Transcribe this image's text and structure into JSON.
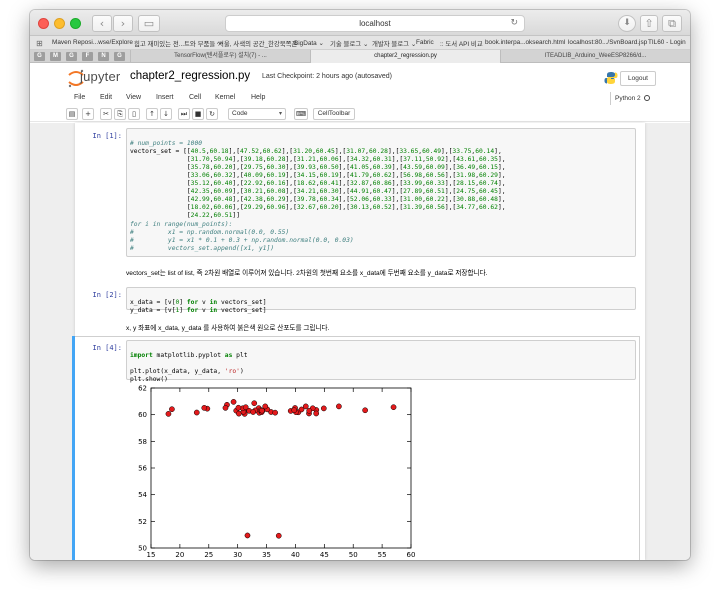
{
  "browser": {
    "url": "localhost",
    "bookmarks": [
      "Maven Reposi...wse/Explore",
      "힘고 재미있는 전...트와 부품들 ^^",
      "서울, 사색의 공간_한강북쪽픈",
      "BigData ⌄",
      "기술 블로그 ⌄",
      "개발자 블로그 ⌄",
      "Fabric",
      ":: 도서 API 비교",
      "book.interpa...oksearch.html",
      "localhost:80.../SvnBoard.jsp",
      "TIL60 - Login"
    ],
    "pinned_tabs": [
      "G",
      "M",
      "G",
      "F",
      "N",
      "G"
    ],
    "tabs": [
      "TensorFlow(텐서플로우) 설치(7) - ...",
      "chapter2_regression.py",
      "ITEADLIB_Arduino_WeeESP8266/d..."
    ]
  },
  "jupyter": {
    "logo_text": "jupyter",
    "notebook_name": "chapter2_regression.py",
    "checkpoint": "Last Checkpoint: 2 hours ago (autosaved)",
    "logout_label": "Logout",
    "menu": [
      "File",
      "Edit",
      "View",
      "Insert",
      "Cell",
      "Kernel",
      "Help"
    ],
    "kernel_name": "Python 2",
    "toolbar": {
      "cell_type": "Code",
      "cell_toolbar_label": "CellToolbar",
      "icons": [
        "save-icon",
        "plus-icon",
        "cut-icon",
        "copy-icon",
        "paste-icon",
        "arrow-up-icon",
        "arrow-down-icon",
        "run-icon",
        "stop-icon",
        "restart-icon",
        "keyboard-icon"
      ]
    }
  },
  "cells": {
    "cell1": {
      "prompt": "In [1]:",
      "code_lines": [
        "# num_points = 1000",
        "vectors_set = [[40.5,60.18],[47.52,60.62],[31.20,60.45],[31.07,60.28],[33.65,60.49],[33.75,60.14],",
        "               [31.70,50.94],[39.18,60.28],[31.21,60.06],[34.32,60.31],[37.11,50.92],[43.61,60.35],",
        "               [35.78,60.20],[29.75,60.30],[39.93,60.50],[41.05,60.39],[43.59,60.09],[36.49,60.15],",
        "               [33.06,60.32],[40.09,60.19],[34.15,60.19],[41.79,60.62],[56.98,60.56],[31.98,60.29],",
        "               [35.12,60.40],[22.92,60.16],[18.62,60.41],[32.87,60.86],[33.99,60.33],[28.15,60.74],",
        "               [42.35,60.09],[30.21,60.08],[34.21,60.30],[44.91,60.47],[27.89,60.51],[24.75,60.45],",
        "               [42.99,60.48],[42.38,60.29],[39.78,60.34],[52.06,60.33],[31.00,60.22],[30.88,60.48],",
        "               [18.02,60.06],[29.29,60.96],[32.67,60.20],[30.13,60.52],[31.39,60.56],[34.77,60.62],",
        "               [24.22,60.51]]",
        "for i in range(num_points):",
        "#         x1 = np.random.normal(0.0, 0.55)",
        "#         y1 = x1 * 0.1 + 0.3 + np.random.normal(0.0, 0.03)",
        "#         vectors_set.append([x1, y1])"
      ]
    },
    "markdown1": "vectors_set는 list of list, 즉 2차원 배열로 이루어져 있습니다. 2차원의 첫번째 요소를 x_data에 두번째 요소를 y_data로 저장합니다.",
    "cell2": {
      "prompt": "In [2]:",
      "code_lines": [
        "x_data = [v[0] for v in vectors_set]",
        "y_data = [v[1] for v in vectors_set]"
      ]
    },
    "markdown2": "x, y 좌표에 x_data, y_data 를 사용하여 붉은색 원으로 산포도를 그립니다.",
    "cell4": {
      "prompt": "In [4]:",
      "code_lines": [
        "import matplotlib.pyplot as plt",
        "",
        "plt.plot(x_data, y_data, 'ro')",
        "plt.show()"
      ]
    }
  },
  "chart_data": {
    "type": "scatter",
    "marker_color": "#e41a1c",
    "xlim": [
      15,
      60
    ],
    "ylim": [
      50,
      62
    ],
    "xticks": [
      15,
      20,
      25,
      30,
      35,
      40,
      45,
      50,
      55,
      60
    ],
    "yticks": [
      50,
      52,
      54,
      56,
      58,
      60,
      62
    ],
    "points": [
      [
        40.5,
        60.18
      ],
      [
        47.52,
        60.62
      ],
      [
        31.2,
        60.45
      ],
      [
        31.07,
        60.28
      ],
      [
        33.65,
        60.49
      ],
      [
        33.75,
        60.14
      ],
      [
        31.7,
        50.94
      ],
      [
        39.18,
        60.28
      ],
      [
        31.21,
        60.06
      ],
      [
        34.32,
        60.31
      ],
      [
        37.11,
        50.92
      ],
      [
        43.61,
        60.35
      ],
      [
        35.78,
        60.2
      ],
      [
        29.75,
        60.3
      ],
      [
        39.93,
        60.5
      ],
      [
        41.05,
        60.39
      ],
      [
        43.59,
        60.09
      ],
      [
        36.49,
        60.15
      ],
      [
        33.06,
        60.32
      ],
      [
        40.09,
        60.19
      ],
      [
        34.15,
        60.19
      ],
      [
        41.79,
        60.62
      ],
      [
        56.98,
        60.56
      ],
      [
        31.98,
        60.29
      ],
      [
        35.12,
        60.4
      ],
      [
        22.92,
        60.16
      ],
      [
        18.62,
        60.41
      ],
      [
        32.87,
        60.86
      ],
      [
        33.99,
        60.33
      ],
      [
        28.15,
        60.74
      ],
      [
        42.35,
        60.09
      ],
      [
        30.21,
        60.08
      ],
      [
        34.21,
        60.3
      ],
      [
        44.91,
        60.47
      ],
      [
        27.89,
        60.51
      ],
      [
        24.75,
        60.45
      ],
      [
        42.99,
        60.48
      ],
      [
        42.38,
        60.29
      ],
      [
        39.78,
        60.34
      ],
      [
        52.06,
        60.33
      ],
      [
        31.0,
        60.22
      ],
      [
        30.88,
        60.48
      ],
      [
        18.02,
        60.06
      ],
      [
        29.29,
        60.96
      ],
      [
        32.67,
        60.2
      ],
      [
        30.13,
        60.52
      ],
      [
        31.39,
        60.56
      ],
      [
        34.77,
        60.62
      ],
      [
        24.22,
        60.51
      ]
    ]
  }
}
